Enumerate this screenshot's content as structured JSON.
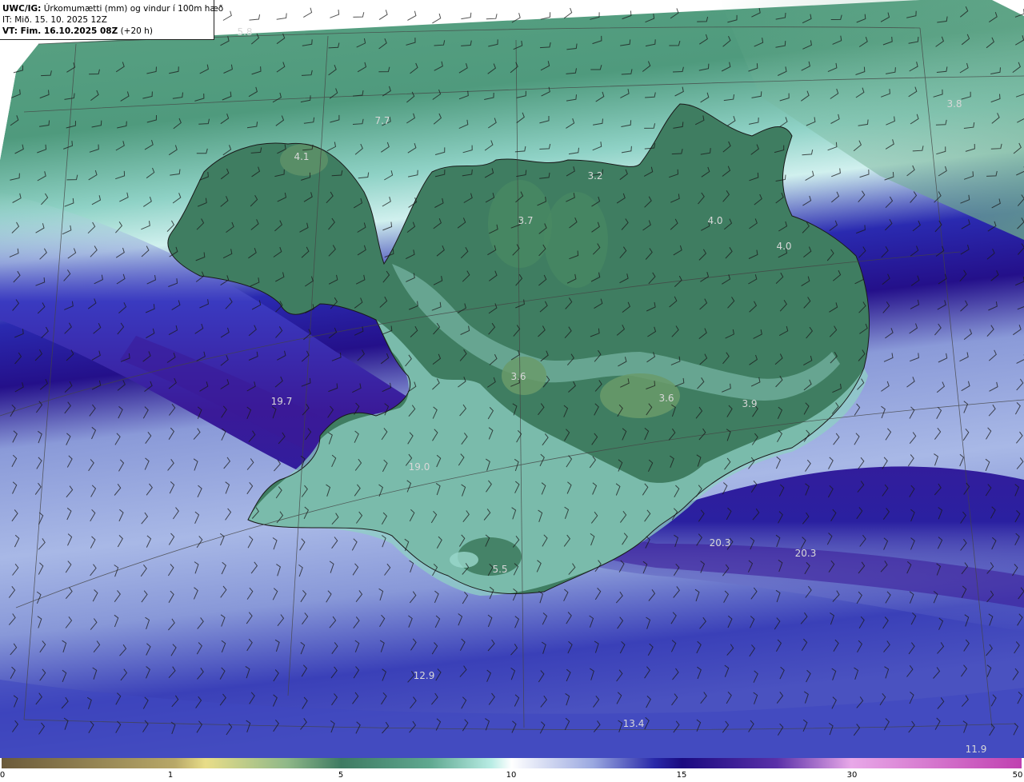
{
  "header": {
    "line1_bold": "UWC/IG:",
    "line1_rest": " Úrkomumætti (mm) og vindur í 100m hæð",
    "line2": "IT: Mið. 15. 10. 2025 12Z",
    "line3_bold": "VT: Fim. 16.10.2025 08Z",
    "line3_rest": " (+20 h)"
  },
  "map_labels": [
    {
      "id": "v1",
      "text": "5.8"
    },
    {
      "id": "v2",
      "text": "7.7"
    },
    {
      "id": "v3",
      "text": "4.1"
    },
    {
      "id": "v4",
      "text": "3.8"
    },
    {
      "id": "v5",
      "text": "3.2"
    },
    {
      "id": "v6",
      "text": "3.7"
    },
    {
      "id": "v7",
      "text": "4.0"
    },
    {
      "id": "v8",
      "text": "4.0"
    },
    {
      "id": "v9",
      "text": "3.6"
    },
    {
      "id": "v10",
      "text": "3.6"
    },
    {
      "id": "v11",
      "text": "3.9"
    },
    {
      "id": "v12",
      "text": "19.7"
    },
    {
      "id": "v13",
      "text": "19.0"
    },
    {
      "id": "v14",
      "text": "20.3"
    },
    {
      "id": "v15",
      "text": "20.3"
    },
    {
      "id": "v16",
      "text": "5.5"
    },
    {
      "id": "v17",
      "text": "12.9"
    },
    {
      "id": "v18",
      "text": "13.4"
    },
    {
      "id": "v19",
      "text": "11.9"
    }
  ],
  "colorbar": {
    "ticks": [
      "0",
      "1",
      "5",
      "10",
      "15",
      "30",
      "50"
    ],
    "colors": [
      "#6b5a3a",
      "#b8a868",
      "#e8dd88",
      "#9fc08a",
      "#3e8a6e",
      "#5fa890",
      "#bfeee8",
      "#ffffff",
      "#9aa8e0",
      "#3030b0",
      "#1a0a80",
      "#5a30a8",
      "#e8a8e8",
      "#c040b0"
    ]
  },
  "palette": {
    "ocean_north": "#4a9a7a",
    "ocean_south": "#a8c0e8",
    "precip_band": "#2a1890",
    "land": "#3e7a5e"
  }
}
